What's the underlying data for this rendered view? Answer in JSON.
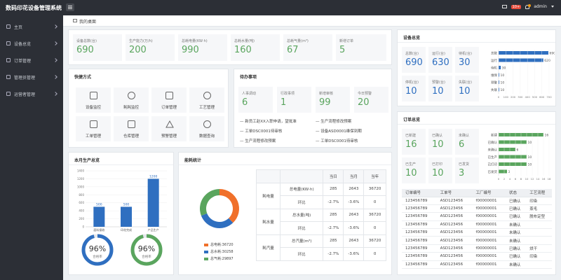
{
  "header": {
    "title": "数码印花设备管理系统",
    "badge": "10+",
    "user": "admin"
  },
  "sidebar": {
    "items": [
      {
        "label": "主页"
      },
      {
        "label": "设备总览"
      },
      {
        "label": "订单管理"
      },
      {
        "label": "管理员管理"
      },
      {
        "label": "运营者管理"
      }
    ]
  },
  "breadcrumb": {
    "label": "我的桌面"
  },
  "top_stats": [
    {
      "label": "设备总数(台)",
      "value": "690"
    },
    {
      "label": "生产能力(万/h)",
      "value": "200"
    },
    {
      "label": "总耗电量(KW·h)",
      "value": "990"
    },
    {
      "label": "总耗水量(吨)",
      "value": "160"
    },
    {
      "label": "总耗气量(m³)",
      "value": "67"
    },
    {
      "label": "新增订单",
      "value": "5"
    }
  ],
  "shortcuts": {
    "title": "快捷方式",
    "items": [
      {
        "label": "设备监控",
        "icon": "grid-icon"
      },
      {
        "label": "耗耗监控",
        "icon": "bulb-icon"
      },
      {
        "label": "订单管理",
        "icon": "document-icon"
      },
      {
        "label": "工艺管理",
        "icon": "cycle-icon"
      },
      {
        "label": "工单管理",
        "icon": "form-icon"
      },
      {
        "label": "仓库管理",
        "icon": "warehouse-icon"
      },
      {
        "label": "预警管理",
        "icon": "warning-icon"
      },
      {
        "label": "数据查询",
        "icon": "search-icon"
      }
    ]
  },
  "todo": {
    "title": "待办事项",
    "stats": [
      {
        "label": "人事调动",
        "value": "6"
      },
      {
        "label": "行政事项",
        "value": "1"
      },
      {
        "label": "新增审核",
        "value": "99"
      },
      {
        "label": "今日预警",
        "value": "20"
      }
    ],
    "items": [
      "新员工赵XX入职申请，望批准",
      "生产流程修改预案",
      "工单DSC0001待审核",
      "设备ASD0001维保到期",
      "生产流程修改预案",
      "工单DSC0001待审核"
    ]
  },
  "device_overview": {
    "title": "设备总览",
    "stats": [
      {
        "label": "总数(台)",
        "value": "690"
      },
      {
        "label": "运行(台)",
        "value": "630"
      },
      {
        "label": "待机(台)",
        "value": "30"
      },
      {
        "label": "停机(台)",
        "value": "10"
      },
      {
        "label": "预警(台)",
        "value": "10"
      },
      {
        "label": "失联(台)",
        "value": "10"
      }
    ],
    "chart_data": {
      "type": "bar",
      "orientation": "horizontal",
      "categories": [
        "总数",
        "运行",
        "待机",
        "维保",
        "预警",
        "失联"
      ],
      "values": [
        690,
        620,
        30,
        10,
        10,
        10
      ],
      "xlim": [
        0,
        700
      ],
      "ticks": [
        0,
        100,
        200,
        300,
        400,
        500,
        600,
        700
      ],
      "color": "#2f6fc0"
    }
  },
  "order_overview": {
    "title": "订单总览",
    "stats": [
      {
        "label": "已新建",
        "value": "16"
      },
      {
        "label": "已确认",
        "value": "10"
      },
      {
        "label": "未确认",
        "value": "6"
      },
      {
        "label": "已生产",
        "value": "10"
      },
      {
        "label": "已打印",
        "value": "10"
      },
      {
        "label": "已发货",
        "value": "3"
      }
    ],
    "chart_data": {
      "type": "bar",
      "orientation": "horizontal",
      "categories": [
        "新建",
        "已确认",
        "未确认",
        "已生产",
        "已打印",
        "已发货"
      ],
      "values": [
        16,
        10,
        6,
        10,
        10,
        3
      ],
      "xlim": [
        0,
        18
      ],
      "ticks": [
        0,
        2,
        4,
        6,
        8,
        10,
        12,
        14,
        16,
        18
      ],
      "color": "#5aa55e"
    },
    "table": {
      "headers": [
        "订单编号",
        "工单号",
        "工厂编号",
        "状态",
        "工艺流程"
      ],
      "rows": [
        [
          "123456789",
          "ASD123456",
          "f00000001",
          "已确认",
          "印染"
        ],
        [
          "123456789",
          "ASD123456",
          "f00000001",
          "已确认",
          "蒸毛"
        ],
        [
          "123456789",
          "ASD123456",
          "f00000001",
          "已确认",
          "脱布定型"
        ],
        [
          "123456789",
          "ASD123456",
          "f00000001",
          "未确认",
          ""
        ],
        [
          "123456789",
          "ASD123456",
          "f00000001",
          "未确认",
          ""
        ],
        [
          "123456789",
          "ASD123456",
          "f00000001",
          "未确认",
          ""
        ],
        [
          "123456789",
          "ASD123456",
          "f00000001",
          "已确认",
          "烘干"
        ],
        [
          "123456789",
          "ASD123456",
          "f00000001",
          "已确认",
          "印染"
        ],
        [
          "123456789",
          "ASD123456",
          "f00000001",
          "未确认",
          ""
        ]
      ]
    }
  },
  "monthly_production": {
    "title": "本月生产总览",
    "chart_data": {
      "type": "bar",
      "categories": [
        "面料接收",
        "印花完成",
        "产品生产"
      ],
      "values": [
        500,
        500,
        1200
      ],
      "ylim": [
        0,
        1400
      ],
      "ticks": [
        0,
        200,
        400,
        600,
        800,
        1000,
        1200,
        1400
      ],
      "color": "#2f6fc0"
    },
    "gauges": [
      {
        "value": "96%",
        "label": "合格率",
        "fraction": 0.96,
        "color": "#2f6fc0"
      },
      {
        "value": "96%",
        "label": "合格率",
        "fraction": 0.96,
        "color": "#5aa55e"
      }
    ]
  },
  "energy": {
    "title": "能耗统计",
    "chart_data": {
      "type": "pie",
      "donut": true,
      "series": [
        {
          "name": "总电耗:36720",
          "value": 36720,
          "color": "#f0702a"
        },
        {
          "name": "总水耗:30258",
          "value": 30258,
          "color": "#2f6fc0"
        },
        {
          "name": "总气耗:29897",
          "value": 29897,
          "color": "#5aa55e"
        }
      ]
    },
    "table": {
      "headers": [
        "",
        "",
        "当日",
        "当月",
        "当年"
      ],
      "groups": [
        {
          "name": "耗电量",
          "rows": [
            [
              "总电量(KW·h)",
              "285",
              "2643",
              "36720"
            ],
            [
              "环比",
              "-2.7%",
              "-3.6%",
              "0"
            ]
          ]
        },
        {
          "name": "耗水量",
          "rows": [
            [
              "总水量(吨)",
              "285",
              "2643",
              "36720"
            ],
            [
              "环比",
              "-2.7%",
              "-3.6%",
              "0"
            ]
          ]
        },
        {
          "name": "耗汽量",
          "rows": [
            [
              "总汽量(m³)",
              "285",
              "2643",
              "36720"
            ],
            [
              "环比",
              "-2.7%",
              "-3.6%",
              "0"
            ]
          ]
        }
      ]
    }
  }
}
